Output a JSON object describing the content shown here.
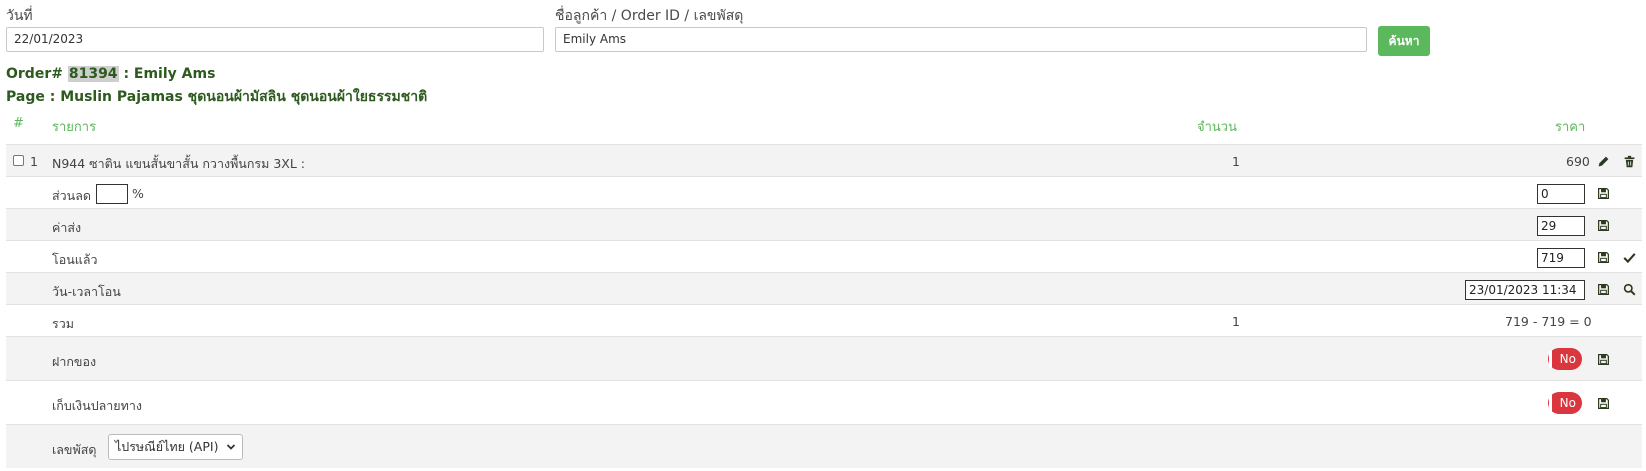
{
  "filters": {
    "date_label": "วันที่",
    "date_value": "22/01/2023",
    "customer_label": "ชื่อลูกค้า / Order ID / เลขพัสดุ",
    "customer_value": "Emily Ams",
    "search_button": "ค้นหา"
  },
  "order": {
    "prefix": "Order#",
    "id": "81394",
    "customer": ": Emily Ams",
    "page_line": "Page : Muslin Pajamas ชุดนอนผ้ามัสลิน ชุดนอนผ้าใยธรรมชาติ"
  },
  "table": {
    "headers": {
      "index": "#",
      "item": "รายการ",
      "qty": "จำนวน",
      "price": "ราคา"
    },
    "item": {
      "index": "1",
      "name": "N944 ซาติน แขนสั้นขาสั้น กวางพื้นกรม 3XL :",
      "qty": "1",
      "price": "690"
    },
    "discount": {
      "label": "ส่วนลด",
      "percent_value": "",
      "percent_sign": "%",
      "amount": "0"
    },
    "shipping": {
      "label": "ค่าส่ง",
      "amount": "29"
    },
    "transferred": {
      "label": "โอนแล้ว",
      "amount": "719"
    },
    "transfer_time": {
      "label": "วัน-เวลาโอน",
      "value": "23/01/2023 11:34"
    },
    "total": {
      "label": "รวม",
      "qty": "1",
      "calc": "719 - 719 = 0"
    },
    "deposit": {
      "label": "ฝากของ",
      "toggle": "No"
    },
    "cod": {
      "label": "เก็บเงินปลายทาง",
      "toggle": "No"
    },
    "tracking": {
      "label": "เลขพัสดุ",
      "carrier": "ไปรษณีย์ไทย (API)"
    }
  }
}
